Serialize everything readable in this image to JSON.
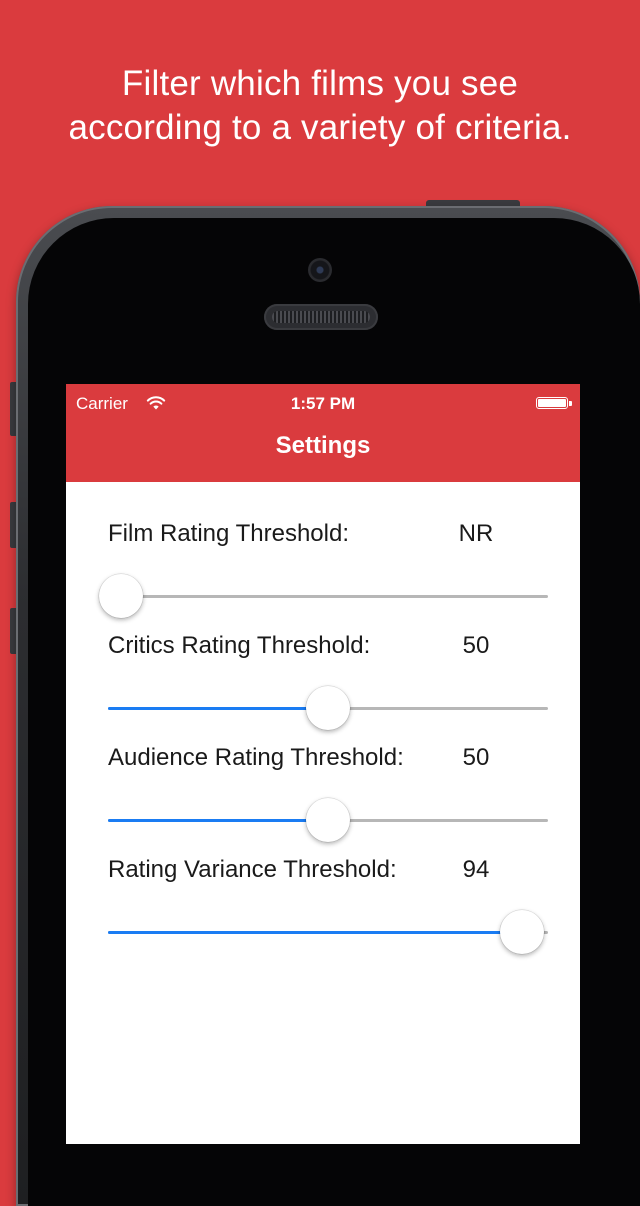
{
  "promo": {
    "line1": "Filter which films you see",
    "line2": "according to a variety of criteria."
  },
  "status_bar": {
    "carrier": "Carrier",
    "time": "1:57 PM",
    "wifi_icon": "wifi-icon",
    "battery_icon": "battery-icon"
  },
  "nav": {
    "title": "Settings"
  },
  "settings": [
    {
      "label": "Film Rating Threshold:",
      "value": "NR",
      "fraction": 0.03
    },
    {
      "label": "Critics Rating Threshold:",
      "value": "50",
      "fraction": 0.5
    },
    {
      "label": "Audience Rating Threshold:",
      "value": "50",
      "fraction": 0.5
    },
    {
      "label": "Rating Variance Threshold:",
      "value": "94",
      "fraction": 0.94
    }
  ],
  "colors": {
    "brand_red": "#da3b3e",
    "slider_fill": "#1a7cf3",
    "slider_track": "#b7b7b7"
  }
}
